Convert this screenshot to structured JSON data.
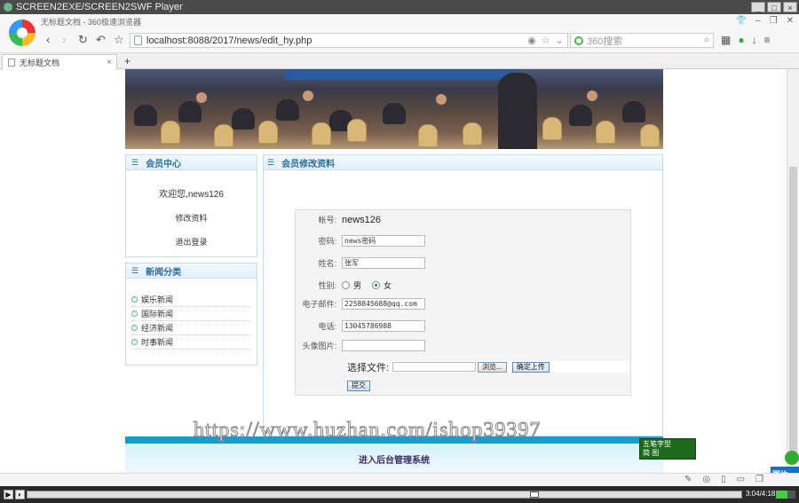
{
  "player": {
    "title": "SCREEN2EXE/SCREEN2SWF Player",
    "time": "3:04/4:18"
  },
  "browser": {
    "window_caption": "无标题文档 - 360极速浏览器",
    "url": "localhost:8088/2017/news/edit_hy.php",
    "search_placeholder": "360搜索",
    "tab_title": "无标题文档",
    "new_tab": "+"
  },
  "sidebar": {
    "member_title": "会员中心",
    "welcome": "欢迎您,news126",
    "edit_profile": "修改资料",
    "logout": "退出登录",
    "news_title": "新闻分类",
    "news_items": [
      "娱乐新闻",
      "国际新闻",
      "经济新闻",
      "时事新闻"
    ]
  },
  "main": {
    "title": "会员修改资料",
    "form": {
      "account_label": "帐号:",
      "account_value": "news126",
      "password_label": "密码:",
      "password_value": "news密码",
      "name_label": "姓名:",
      "name_value": "张军",
      "gender_label": "性别:",
      "gender_male": "男",
      "gender_female": "女",
      "email_label": "电子邮件:",
      "email_value": "2258845688@qq.com",
      "phone_label": "电话:",
      "phone_value": "13045786988",
      "avatar_label": "头像图片:",
      "file_label": "选择文件:",
      "browse_label": "浏览...",
      "upload_label": "确定上传",
      "submit_label": "提交"
    }
  },
  "footer": {
    "admin_link": "进入后台管理系统"
  },
  "watermark": "https://www.huzhan.com/ishop39397",
  "ime": {
    "line1": "五笔字型",
    "line2": "简 图"
  },
  "badge": "图片"
}
